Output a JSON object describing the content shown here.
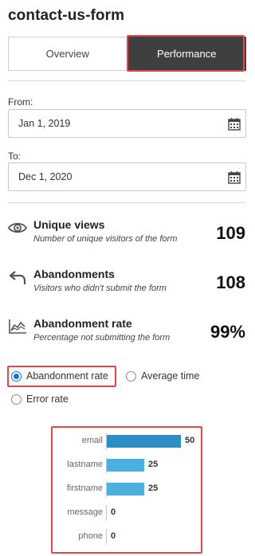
{
  "title": "contact-us-form",
  "tabs": {
    "overview": "Overview",
    "performance": "Performance"
  },
  "filters": {
    "from_label": "From:",
    "from_value": "Jan 1, 2019",
    "to_label": "To:",
    "to_value": "Dec 1, 2020"
  },
  "stats": {
    "views": {
      "title": "Unique views",
      "desc": "Number of unique visitors of the form",
      "value": "109",
      "icon": "eye-icon"
    },
    "abandonments": {
      "title": "Abandonments",
      "desc": "Visitors who didn't submit the form",
      "value": "108",
      "icon": "undo-arrow-icon"
    },
    "rate": {
      "title": "Abandonment rate",
      "desc": "Percentage not submitting the form",
      "value": "99%",
      "icon": "area-chart-icon"
    }
  },
  "metric_options": {
    "abandonment_rate": "Abandonment rate",
    "average_time": "Average time",
    "error_rate": "Error rate",
    "selected": "abandonment_rate"
  },
  "colors": {
    "accent": "#1a73d8",
    "active_tab": "#3f3f3f",
    "highlight": "#e3474c",
    "bar_top": "#2e8fc4",
    "bar": "#4bb0dd"
  },
  "chart_data": {
    "type": "bar",
    "orientation": "horizontal",
    "categories": [
      "email",
      "lastname",
      "firstname",
      "message",
      "phone"
    ],
    "values": [
      50,
      25,
      25,
      0,
      0
    ],
    "xlim": [
      0,
      50
    ]
  }
}
